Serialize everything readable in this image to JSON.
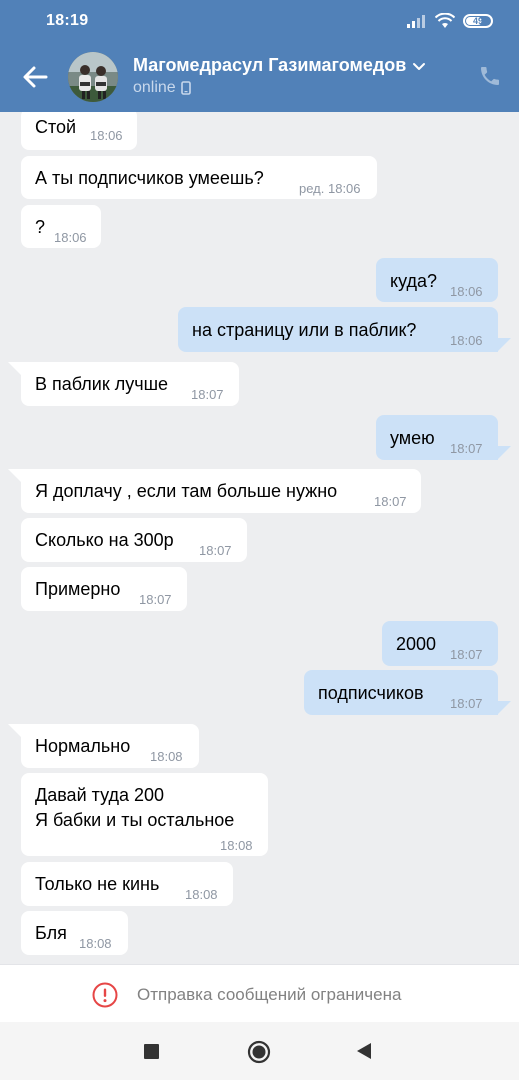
{
  "status_bar": {
    "time": "18:19",
    "battery": "49"
  },
  "header": {
    "name": "Магомедрасул Газимагомедов",
    "status": "online"
  },
  "messages": [
    {
      "dir": "in",
      "text": "Стой",
      "time": "18:06"
    },
    {
      "dir": "in",
      "text": "А ты подписчиков умеешь?",
      "time": "ред. 18:06"
    },
    {
      "dir": "in",
      "text": "?",
      "time": "18:06"
    },
    {
      "dir": "out",
      "text": "куда?",
      "time": "18:06"
    },
    {
      "dir": "out",
      "text": "на страницу или в паблик?",
      "time": "18:06"
    },
    {
      "dir": "in",
      "text": "В паблик лучше",
      "time": "18:07"
    },
    {
      "dir": "out",
      "text": "умею",
      "time": "18:07"
    },
    {
      "dir": "in",
      "text": "Я доплачу , если там больше нужно",
      "time": "18:07"
    },
    {
      "dir": "in",
      "text": "Сколько на 300р",
      "time": "18:07"
    },
    {
      "dir": "in",
      "text": "Примерно",
      "time": "18:07"
    },
    {
      "dir": "out",
      "text": "2000",
      "time": "18:07"
    },
    {
      "dir": "out",
      "text": "подписчиков",
      "time": "18:07"
    },
    {
      "dir": "in",
      "text": "Нормально",
      "time": "18:08"
    },
    {
      "dir": "in",
      "text": "Давай туда 200",
      "text2": "Я бабки и ты остальное",
      "time": "18:08"
    },
    {
      "dir": "in",
      "text": "Только не кинь",
      "time": "18:08"
    },
    {
      "dir": "in",
      "text": "Бля",
      "time": "18:08"
    }
  ],
  "footer": {
    "restricted": "Отправка сообщений ограничена"
  },
  "icons": {
    "back": "arrow-left-icon",
    "chevron": "chevron-down-icon",
    "mobile": "mobile-phone-icon",
    "call": "phone-icon",
    "restricted": "exclamation-circle-icon",
    "nav_recents": "square-icon",
    "nav_home": "circle-icon",
    "nav_back": "triangle-back-icon"
  },
  "colors": {
    "header": "#5181b8",
    "incoming_bubble": "#ffffff",
    "outgoing_bubble": "#cce1f7",
    "chat_background": "#edeef0",
    "alert": "#e64646"
  }
}
